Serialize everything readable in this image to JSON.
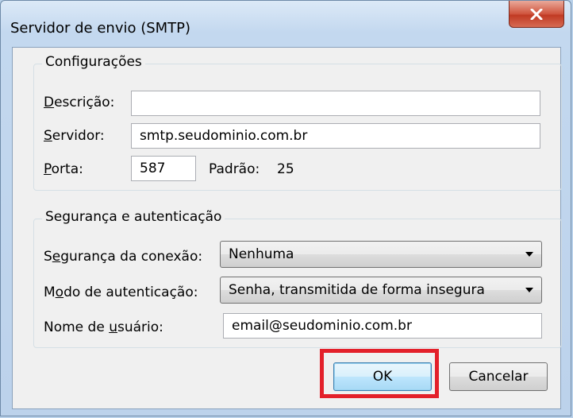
{
  "window": {
    "title": "Servidor de envio (SMTP)"
  },
  "settings": {
    "legend": "Configurações",
    "description_label_first": "D",
    "description_label_rest": "escrição:",
    "description_value": "",
    "server_label_first": "S",
    "server_label_rest": "ervidor:",
    "server_value": "smtp.seudominio.com.br",
    "port_label_first": "P",
    "port_label_rest": "orta:",
    "port_value": "587",
    "default_label": "Padrão:",
    "default_value": "25"
  },
  "security": {
    "legend": "Segurança e autenticação",
    "connection_label_pre": "S",
    "connection_label_key": "e",
    "connection_label_post": "gurança da conexão:",
    "connection_value": "Nenhuma",
    "auth_label_pre": "M",
    "auth_label_key": "o",
    "auth_label_post": "do de autenticação:",
    "auth_value": "Senha, transmitida de forma insegura",
    "username_label_pre": "Nome de ",
    "username_label_key": "u",
    "username_label_post": "suário:",
    "username_value": "email@seudominio.com.br"
  },
  "buttons": {
    "ok": "OK",
    "cancel": "Cancelar"
  },
  "colors": {
    "highlight": "#e3202a",
    "close_button": "#c03a23",
    "window_frame": "#bcd2eb"
  },
  "icons": {
    "close": "close-icon"
  }
}
